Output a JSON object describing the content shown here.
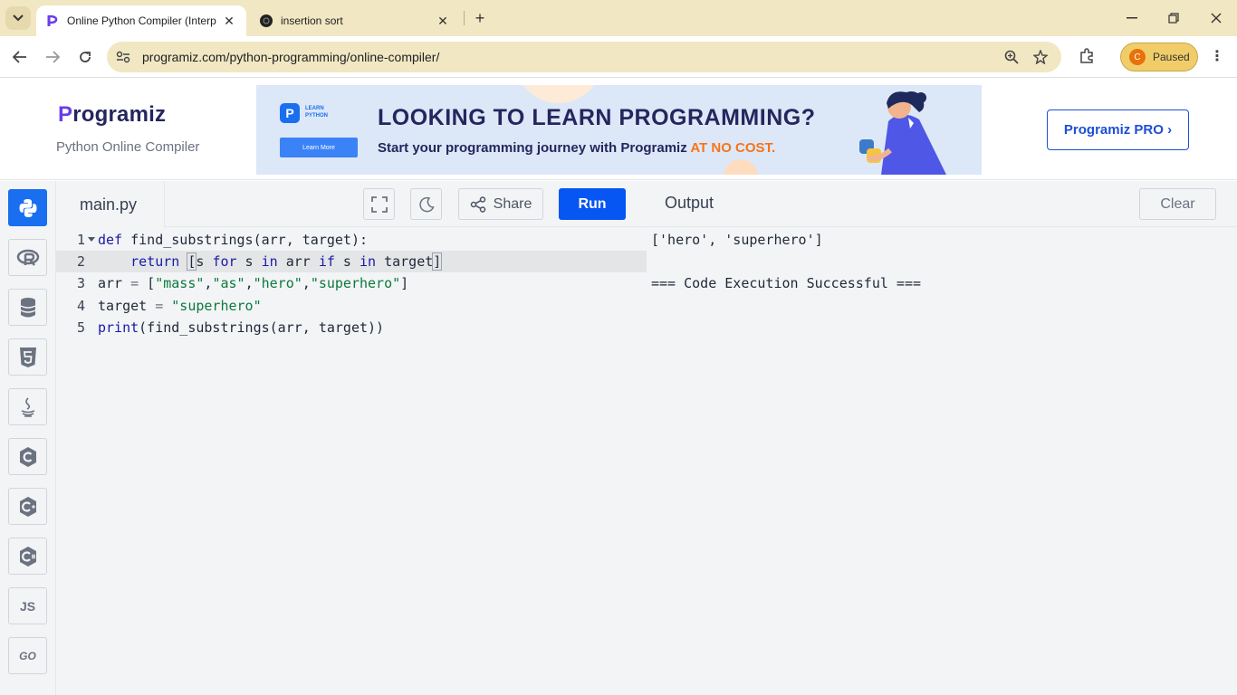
{
  "browser": {
    "tabs": [
      {
        "title": "Online Python Compiler (Interp",
        "active": true
      },
      {
        "title": "insertion sort",
        "active": false
      }
    ],
    "url": "programiz.com/python-programming/online-compiler/",
    "profile_label": "Paused",
    "profile_initial": "C"
  },
  "site": {
    "logo": "Programiz",
    "logo_rest": "rogramiz",
    "subtitle": "Python Online Compiler",
    "banner": {
      "card_label_1": "LEARN",
      "card_label_2": "PYTHON",
      "card_button": "Learn More",
      "headline": "LOOKING TO LEARN PROGRAMMING?",
      "subline": "Start your programming journey with Programiz ",
      "subline_highlight": "AT NO COST."
    },
    "pro_button": "Programiz PRO ›"
  },
  "editor": {
    "filename": "main.py",
    "share_label": "Share",
    "run_label": "Run",
    "line_numbers": [
      "1",
      "2",
      "3",
      "4",
      "5"
    ],
    "code_lines": [
      "def find_substrings(arr, target):",
      "    return [s for s in arr if s in target]",
      "arr = [\"mass\",\"as\",\"hero\",\"superhero\"]",
      "target = \"superhero\"",
      "print(find_substrings(arr, target))"
    ]
  },
  "languages": [
    "python",
    "r",
    "sql",
    "html",
    "java",
    "c",
    "cpp",
    "csharp",
    "JS",
    "GO"
  ],
  "output": {
    "title": "Output",
    "clear_label": "Clear",
    "lines": [
      "['hero', 'superhero']",
      "",
      "=== Code Execution Successful ==="
    ]
  },
  "colors": {
    "accent": "#0556f3",
    "brand": "#6a3de8",
    "chrome": "#f1e7c2"
  }
}
